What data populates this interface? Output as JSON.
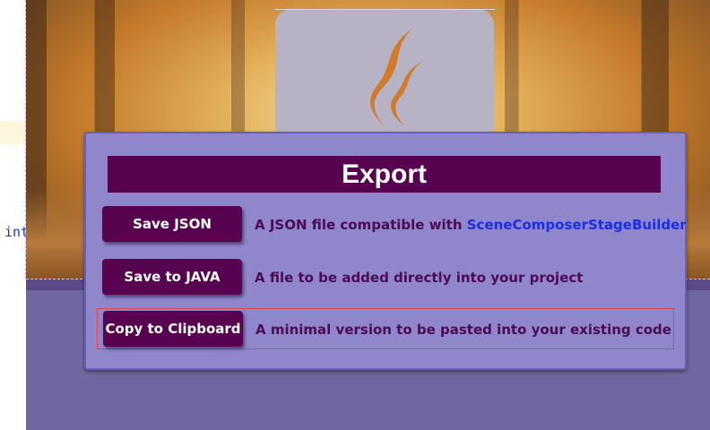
{
  "editor": {
    "code_fragment": "int"
  },
  "dialog": {
    "title": "Export",
    "options": [
      {
        "button_label": "Save JSON",
        "description": "A JSON file compatible with ",
        "link_text": "SceneComposerStageBuilder"
      },
      {
        "button_label": "Save to JAVA",
        "description": "A file to be added directly into your project"
      },
      {
        "button_label": "Copy to Clipboard",
        "description": "A minimal version to be pasted into your existing code",
        "selected": true
      }
    ]
  },
  "colors": {
    "dialog_background": "#8f86cc",
    "title_background": "#57034f",
    "button_background": "#57034f",
    "description_text": "#4b0b55",
    "link_text": "#1a2ee8",
    "selection_border": "#e04848"
  },
  "icons": {
    "logo": "java-logo-icon"
  }
}
